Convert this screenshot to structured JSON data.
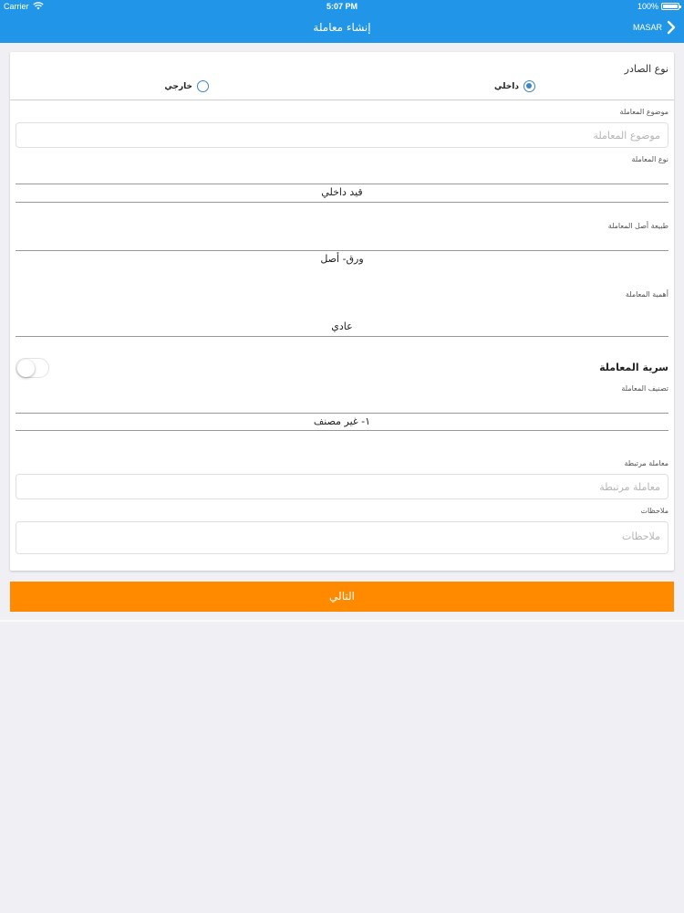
{
  "status_bar": {
    "carrier": "Carrier",
    "time": "5:07 PM",
    "battery": "100%"
  },
  "nav": {
    "title": "إنشاء معاملة",
    "back_label": "MASAR"
  },
  "form": {
    "issuer_type": {
      "label": "نوع الصادر",
      "option_internal": "داخلي",
      "option_external": "خارجي",
      "selected": "داخلي"
    },
    "subject": {
      "label": "موضوع المعاملة",
      "placeholder": "موضوع المعاملة",
      "value": ""
    },
    "transaction_type": {
      "label": "نوع المعاملة",
      "value": "قيد داخلي"
    },
    "original_nature": {
      "label": "طبيعة أصل المعاملة",
      "value": "ورق- أصل"
    },
    "importance": {
      "label": "أهمية المعاملة",
      "value": "عادي"
    },
    "confidentiality": {
      "label": "سرية المعاملة",
      "on": false
    },
    "classification": {
      "label": "تصنيف المعاملة",
      "value": "١- غير مصنف"
    },
    "related": {
      "label": "معاملة مرتبطة",
      "placeholder": "معاملة مرتبطة",
      "value": ""
    },
    "notes": {
      "label": "ملاحظات",
      "placeholder": "ملاحظات",
      "value": ""
    }
  },
  "actions": {
    "next_label": "التالي"
  },
  "colors": {
    "nav": "#2196e8",
    "accent": "#ff8a00",
    "radio": "#3a84c9"
  }
}
